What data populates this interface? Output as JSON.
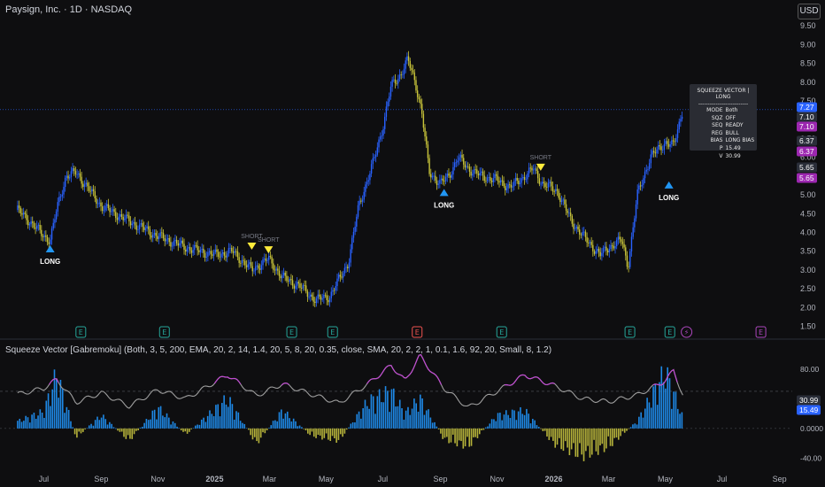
{
  "header": {
    "symbol_title": "Paysign, Inc. · 1D · NASDAQ",
    "currency_button": "USD"
  },
  "indicator": {
    "title": "Squeeze Vector [Gabremoku] (Both, 3, 5, 200, EMA, 20, 2, 14, 1.4, 20, 5, 8, 20, 0.35, close, SMA, 20, 2, 2, 1, 0.1, 1.6, 92, 20, Small, 8, 1.2)"
  },
  "info_panel": {
    "title": "SQUEEZE VECTOR | LONG",
    "separator": "--------------------------",
    "rows": [
      {
        "k": "MODE",
        "v": "Both"
      },
      {
        "k": "SQZ",
        "v": "OFF"
      },
      {
        "k": "SEQ",
        "v": "READY"
      },
      {
        "k": "REG",
        "v": "BULL"
      },
      {
        "k": "BIAS",
        "v": "LONG BIAS"
      },
      {
        "k": "P",
        "v": "15.49"
      },
      {
        "k": "V",
        "v": "30.99"
      }
    ]
  },
  "colors": {
    "background": "#0e0e10",
    "up_candle": "#2962ff",
    "down_candle": "#c8c43a",
    "long_marker": "#2196f3",
    "short_marker": "#ffeb3b",
    "osc_line": "#9e9e9e",
    "osc_line_hot": "#c04bd1",
    "hist_pos": "#1e88e5",
    "hist_neg": "#b5b23a",
    "price_label_blue": "#2962ff",
    "price_label_purple": "#9c27b0",
    "price_label_gray": "#2a2e39",
    "earnings_green": "#26a69a",
    "earnings_red": "#ef5350",
    "dividend_purple": "#ab47bc"
  },
  "chart_data": [
    {
      "type": "line",
      "name": "price",
      "y_ticks": [
        "9.50",
        "9.00",
        "8.50",
        "8.00",
        "7.50",
        "7.00",
        "6.50",
        "6.00",
        "5.50",
        "5.00",
        "4.50",
        "4.00",
        "3.50",
        "3.00",
        "2.50",
        "2.00",
        "1.50"
      ],
      "ylim": [
        1.3,
        9.6
      ],
      "x_ticks": [
        "Jul",
        "Sep",
        "Nov",
        "2025",
        "Mar",
        "May",
        "Jul",
        "Sep",
        "Nov",
        "2026",
        "Mar",
        "May",
        "Jul",
        "Sep"
      ],
      "x": [
        "2024-06-03",
        "2024-06-20",
        "2024-07-01",
        "2024-07-08",
        "2024-07-15",
        "2024-07-25",
        "2024-08-05",
        "2024-09-01",
        "2024-10-01",
        "2024-11-01",
        "2024-12-01",
        "2025-01-02",
        "2025-01-20",
        "2025-02-10",
        "2025-02-28",
        "2025-03-15",
        "2025-04-01",
        "2025-04-20",
        "2025-05-05",
        "2025-05-25",
        "2025-06-05",
        "2025-06-20",
        "2025-07-01",
        "2025-07-10",
        "2025-07-20",
        "2025-07-28",
        "2025-08-05",
        "2025-08-12",
        "2025-08-20",
        "2025-09-01",
        "2025-09-10",
        "2025-09-20",
        "2025-10-01",
        "2025-10-15",
        "2025-11-01",
        "2025-11-15",
        "2025-12-01",
        "2025-12-10",
        "2025-12-20",
        "2026-01-05",
        "2026-01-20",
        "2026-02-05",
        "2026-02-20",
        "2026-03-01",
        "2026-03-15",
        "2026-03-22",
        "2026-04-01",
        "2026-04-15",
        "2026-05-01",
        "2026-05-10",
        "2026-05-20"
      ],
      "close": [
        4.6,
        4.2,
        3.9,
        3.8,
        4.6,
        5.5,
        5.6,
        4.7,
        4.3,
        3.9,
        3.6,
        3.4,
        3.5,
        3.0,
        3.3,
        2.8,
        2.6,
        2.2,
        2.3,
        3.2,
        4.7,
        5.8,
        6.8,
        7.9,
        8.2,
        8.6,
        8.0,
        7.2,
        5.6,
        5.3,
        5.5,
        6.0,
        5.7,
        5.5,
        5.4,
        5.2,
        5.5,
        5.7,
        5.3,
        5.1,
        4.3,
        3.8,
        3.4,
        3.6,
        3.8,
        3.1,
        5.0,
        6.0,
        6.4,
        6.3,
        7.3
      ],
      "current_price": "7.27",
      "price_labels": [
        {
          "value": "7.27",
          "bg": "blue"
        },
        {
          "value": "7.10",
          "bg": "gray"
        },
        {
          "value": "7.10",
          "bg": "purple"
        },
        {
          "value": "6.37",
          "bg": "gray"
        },
        {
          "value": "6.37",
          "bg": "purple"
        },
        {
          "value": "5.65",
          "bg": "gray"
        },
        {
          "value": "5.65",
          "bg": "purple"
        }
      ],
      "annotations": [
        {
          "text": "LONG",
          "date": "2024-07-08",
          "price": 3.8,
          "kind": "long"
        },
        {
          "text": "SHORT",
          "date": "2025-02-10",
          "price": 3.4,
          "kind": "short"
        },
        {
          "text": "SHORT",
          "date": "2025-02-28",
          "price": 3.3,
          "kind": "short"
        },
        {
          "text": "LONG",
          "date": "2025-09-05",
          "price": 5.3,
          "kind": "long"
        },
        {
          "text": "SHORT",
          "date": "2025-12-18",
          "price": 5.5,
          "kind": "short"
        },
        {
          "text": "LONG",
          "date": "2026-05-05",
          "price": 5.5,
          "kind": "long"
        }
      ],
      "events": [
        {
          "date": "2024-08-10",
          "glyph": "E",
          "kind": "earnings_green"
        },
        {
          "date": "2024-11-08",
          "glyph": "E",
          "kind": "earnings_green"
        },
        {
          "date": "2025-03-25",
          "glyph": "E",
          "kind": "earnings_green"
        },
        {
          "date": "2025-05-08",
          "glyph": "E",
          "kind": "earnings_green"
        },
        {
          "date": "2025-08-07",
          "glyph": "E",
          "kind": "earnings_red"
        },
        {
          "date": "2025-11-06",
          "glyph": "E",
          "kind": "earnings_green"
        },
        {
          "date": "2026-03-24",
          "glyph": "E",
          "kind": "earnings_green"
        },
        {
          "date": "2026-05-06",
          "glyph": "E",
          "kind": "earnings_green"
        },
        {
          "date": "2026-05-24",
          "glyph": "⚡",
          "kind": "dividend_purple"
        },
        {
          "date": "2026-08-12",
          "glyph": "E",
          "kind": "dividend_purple"
        }
      ]
    },
    {
      "type": "line",
      "name": "oscillator",
      "y_ticks": [
        "80.00",
        "40.00",
        "0.0000",
        "-40.00"
      ],
      "ylim": [
        -55,
        100
      ],
      "reference_line": 50,
      "x": [
        "2024-06-03",
        "2024-07-01",
        "2024-07-15",
        "2024-08-05",
        "2024-09-01",
        "2024-10-01",
        "2024-11-01",
        "2024-12-01",
        "2025-01-15",
        "2025-02-15",
        "2025-03-15",
        "2025-04-15",
        "2025-05-15",
        "2025-06-15",
        "2025-07-10",
        "2025-07-25",
        "2025-08-10",
        "2025-09-05",
        "2025-10-01",
        "2025-11-01",
        "2025-12-01",
        "2026-01-01",
        "2026-02-01",
        "2026-03-01",
        "2026-04-01",
        "2026-05-01",
        "2026-05-10",
        "2026-05-20"
      ],
      "line": [
        46,
        54,
        66,
        35,
        48,
        30,
        52,
        40,
        72,
        44,
        60,
        46,
        34,
        60,
        85,
        64,
        98,
        54,
        28,
        50,
        72,
        58,
        40,
        36,
        45,
        64,
        78,
        45
      ],
      "histogram": [
        12,
        28,
        90,
        -15,
        22,
        -20,
        35,
        -10,
        50,
        -25,
        30,
        -12,
        -20,
        45,
        62,
        25,
        50,
        -18,
        -30,
        22,
        30,
        -25,
        -45,
        -30,
        12,
        95,
        60,
        18
      ],
      "current_labels": [
        {
          "value": "30.99",
          "bg": "gray"
        },
        {
          "value": "15.49",
          "bg": "blue"
        }
      ]
    }
  ]
}
